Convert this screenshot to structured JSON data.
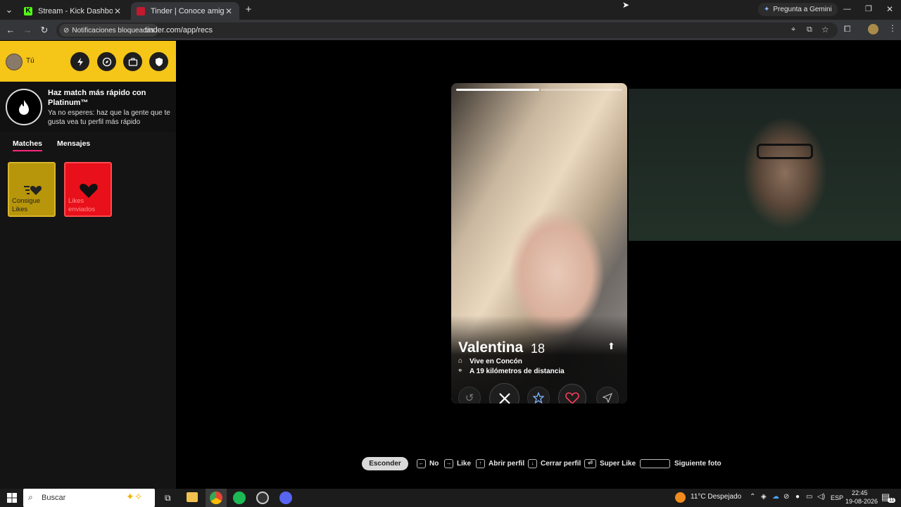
{
  "browser": {
    "tabs": [
      {
        "title": "Stream - Kick Dashboard",
        "favicon": "kick-icon",
        "active": false
      },
      {
        "title": "Tinder | Conoce amigos y gente",
        "favicon": "tinder-icon",
        "active": true
      }
    ],
    "gemini_button": "Pregunta a Gemini",
    "site_chip": "Notificaciones bloqueadas",
    "url": "tinder.com/app/recs"
  },
  "sidebar": {
    "user_label": "Tú",
    "promo_title": "Haz match más rápido con Platinum™",
    "promo_subtitle": "Ya no esperes: haz que la gente que te gusta vea tu perfil más rápido",
    "tabs": [
      {
        "label": "Matches",
        "active": true
      },
      {
        "label": "Mensajes",
        "active": false
      }
    ],
    "cards": [
      {
        "label": "Consigue Likes",
        "color": "#b8960b"
      },
      {
        "label": "Likes enviados",
        "color": "#e8101a"
      }
    ]
  },
  "profile": {
    "name": "Valentina",
    "age": "18",
    "home": "Vive en Concón",
    "distance": "A 19 kilómetros de distancia",
    "photo_count": 2,
    "current_photo": 1
  },
  "shortcuts": {
    "hide_button": "Esconder",
    "items": [
      {
        "key": "←",
        "label": "No"
      },
      {
        "key": "→",
        "label": "Like"
      },
      {
        "key": "↑",
        "label": "Abrir perfil"
      },
      {
        "key": "↓",
        "label": "Cerrar perfil"
      },
      {
        "key": "⏎",
        "label": "Super Like"
      },
      {
        "key": "",
        "label": "Siguiente foto"
      }
    ]
  },
  "taskbar": {
    "search_placeholder": "Buscar",
    "weather": "11°C  Despejado",
    "lang": "ESP",
    "time": "22:45",
    "date": "19-08-2026",
    "notification_count": "11"
  },
  "colors": {
    "tinder_pink": "#fd267d",
    "sidebar_header": "#f5c518",
    "like_red": "#e8101a",
    "gold": "#b8960b"
  }
}
